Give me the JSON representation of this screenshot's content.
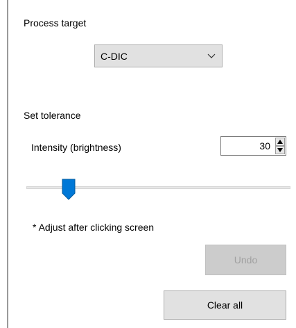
{
  "panel": {
    "process_target": {
      "label": "Process target",
      "dropdown": {
        "selected": "C-DIC",
        "icon": "chevron-down-icon"
      }
    },
    "tolerance": {
      "label": "Set tolerance",
      "intensity_label": "Intensity (brightness)",
      "intensity_value": "30",
      "slider_fraction": 0.14,
      "note": "* Adjust after clicking screen"
    },
    "buttons": {
      "undo_label": "Undo",
      "undo_enabled": false,
      "clear_label": "Clear all"
    }
  },
  "colors": {
    "button_face": "#e1e1e1",
    "disabled_button_face": "#cccccc",
    "disabled_text": "#a0a0a0",
    "slider_thumb": "#0078d7",
    "slider_track": "#e7e7e7"
  }
}
